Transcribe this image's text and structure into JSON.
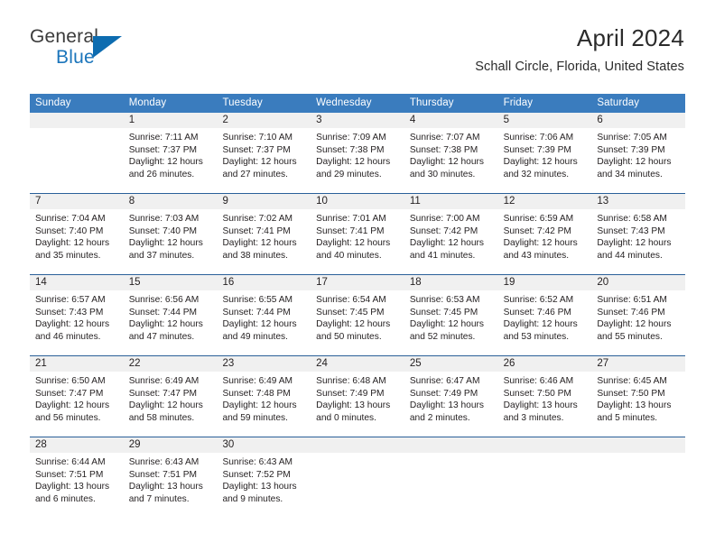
{
  "brand": {
    "name_part1": "General",
    "name_part2": "Blue",
    "logo_icon": "triangle-logo-icon"
  },
  "header": {
    "title": "April 2024",
    "subtitle": "Schall Circle, Florida, United States"
  },
  "calendar": {
    "weekdays": [
      "Sunday",
      "Monday",
      "Tuesday",
      "Wednesday",
      "Thursday",
      "Friday",
      "Saturday"
    ],
    "accent_color": "#3a7cbe",
    "daynum_band_color": "#f0f0f0",
    "weeks": [
      [
        {
          "day": "",
          "sunrise": "",
          "sunset": "",
          "daylight1": "",
          "daylight2": ""
        },
        {
          "day": "1",
          "sunrise": "Sunrise: 7:11 AM",
          "sunset": "Sunset: 7:37 PM",
          "daylight1": "Daylight: 12 hours",
          "daylight2": "and 26 minutes."
        },
        {
          "day": "2",
          "sunrise": "Sunrise: 7:10 AM",
          "sunset": "Sunset: 7:37 PM",
          "daylight1": "Daylight: 12 hours",
          "daylight2": "and 27 minutes."
        },
        {
          "day": "3",
          "sunrise": "Sunrise: 7:09 AM",
          "sunset": "Sunset: 7:38 PM",
          "daylight1": "Daylight: 12 hours",
          "daylight2": "and 29 minutes."
        },
        {
          "day": "4",
          "sunrise": "Sunrise: 7:07 AM",
          "sunset": "Sunset: 7:38 PM",
          "daylight1": "Daylight: 12 hours",
          "daylight2": "and 30 minutes."
        },
        {
          "day": "5",
          "sunrise": "Sunrise: 7:06 AM",
          "sunset": "Sunset: 7:39 PM",
          "daylight1": "Daylight: 12 hours",
          "daylight2": "and 32 minutes."
        },
        {
          "day": "6",
          "sunrise": "Sunrise: 7:05 AM",
          "sunset": "Sunset: 7:39 PM",
          "daylight1": "Daylight: 12 hours",
          "daylight2": "and 34 minutes."
        }
      ],
      [
        {
          "day": "7",
          "sunrise": "Sunrise: 7:04 AM",
          "sunset": "Sunset: 7:40 PM",
          "daylight1": "Daylight: 12 hours",
          "daylight2": "and 35 minutes."
        },
        {
          "day": "8",
          "sunrise": "Sunrise: 7:03 AM",
          "sunset": "Sunset: 7:40 PM",
          "daylight1": "Daylight: 12 hours",
          "daylight2": "and 37 minutes."
        },
        {
          "day": "9",
          "sunrise": "Sunrise: 7:02 AM",
          "sunset": "Sunset: 7:41 PM",
          "daylight1": "Daylight: 12 hours",
          "daylight2": "and 38 minutes."
        },
        {
          "day": "10",
          "sunrise": "Sunrise: 7:01 AM",
          "sunset": "Sunset: 7:41 PM",
          "daylight1": "Daylight: 12 hours",
          "daylight2": "and 40 minutes."
        },
        {
          "day": "11",
          "sunrise": "Sunrise: 7:00 AM",
          "sunset": "Sunset: 7:42 PM",
          "daylight1": "Daylight: 12 hours",
          "daylight2": "and 41 minutes."
        },
        {
          "day": "12",
          "sunrise": "Sunrise: 6:59 AM",
          "sunset": "Sunset: 7:42 PM",
          "daylight1": "Daylight: 12 hours",
          "daylight2": "and 43 minutes."
        },
        {
          "day": "13",
          "sunrise": "Sunrise: 6:58 AM",
          "sunset": "Sunset: 7:43 PM",
          "daylight1": "Daylight: 12 hours",
          "daylight2": "and 44 minutes."
        }
      ],
      [
        {
          "day": "14",
          "sunrise": "Sunrise: 6:57 AM",
          "sunset": "Sunset: 7:43 PM",
          "daylight1": "Daylight: 12 hours",
          "daylight2": "and 46 minutes."
        },
        {
          "day": "15",
          "sunrise": "Sunrise: 6:56 AM",
          "sunset": "Sunset: 7:44 PM",
          "daylight1": "Daylight: 12 hours",
          "daylight2": "and 47 minutes."
        },
        {
          "day": "16",
          "sunrise": "Sunrise: 6:55 AM",
          "sunset": "Sunset: 7:44 PM",
          "daylight1": "Daylight: 12 hours",
          "daylight2": "and 49 minutes."
        },
        {
          "day": "17",
          "sunrise": "Sunrise: 6:54 AM",
          "sunset": "Sunset: 7:45 PM",
          "daylight1": "Daylight: 12 hours",
          "daylight2": "and 50 minutes."
        },
        {
          "day": "18",
          "sunrise": "Sunrise: 6:53 AM",
          "sunset": "Sunset: 7:45 PM",
          "daylight1": "Daylight: 12 hours",
          "daylight2": "and 52 minutes."
        },
        {
          "day": "19",
          "sunrise": "Sunrise: 6:52 AM",
          "sunset": "Sunset: 7:46 PM",
          "daylight1": "Daylight: 12 hours",
          "daylight2": "and 53 minutes."
        },
        {
          "day": "20",
          "sunrise": "Sunrise: 6:51 AM",
          "sunset": "Sunset: 7:46 PM",
          "daylight1": "Daylight: 12 hours",
          "daylight2": "and 55 minutes."
        }
      ],
      [
        {
          "day": "21",
          "sunrise": "Sunrise: 6:50 AM",
          "sunset": "Sunset: 7:47 PM",
          "daylight1": "Daylight: 12 hours",
          "daylight2": "and 56 minutes."
        },
        {
          "day": "22",
          "sunrise": "Sunrise: 6:49 AM",
          "sunset": "Sunset: 7:47 PM",
          "daylight1": "Daylight: 12 hours",
          "daylight2": "and 58 minutes."
        },
        {
          "day": "23",
          "sunrise": "Sunrise: 6:49 AM",
          "sunset": "Sunset: 7:48 PM",
          "daylight1": "Daylight: 12 hours",
          "daylight2": "and 59 minutes."
        },
        {
          "day": "24",
          "sunrise": "Sunrise: 6:48 AM",
          "sunset": "Sunset: 7:49 PM",
          "daylight1": "Daylight: 13 hours",
          "daylight2": "and 0 minutes."
        },
        {
          "day": "25",
          "sunrise": "Sunrise: 6:47 AM",
          "sunset": "Sunset: 7:49 PM",
          "daylight1": "Daylight: 13 hours",
          "daylight2": "and 2 minutes."
        },
        {
          "day": "26",
          "sunrise": "Sunrise: 6:46 AM",
          "sunset": "Sunset: 7:50 PM",
          "daylight1": "Daylight: 13 hours",
          "daylight2": "and 3 minutes."
        },
        {
          "day": "27",
          "sunrise": "Sunrise: 6:45 AM",
          "sunset": "Sunset: 7:50 PM",
          "daylight1": "Daylight: 13 hours",
          "daylight2": "and 5 minutes."
        }
      ],
      [
        {
          "day": "28",
          "sunrise": "Sunrise: 6:44 AM",
          "sunset": "Sunset: 7:51 PM",
          "daylight1": "Daylight: 13 hours",
          "daylight2": "and 6 minutes."
        },
        {
          "day": "29",
          "sunrise": "Sunrise: 6:43 AM",
          "sunset": "Sunset: 7:51 PM",
          "daylight1": "Daylight: 13 hours",
          "daylight2": "and 7 minutes."
        },
        {
          "day": "30",
          "sunrise": "Sunrise: 6:43 AM",
          "sunset": "Sunset: 7:52 PM",
          "daylight1": "Daylight: 13 hours",
          "daylight2": "and 9 minutes."
        },
        {
          "day": "",
          "sunrise": "",
          "sunset": "",
          "daylight1": "",
          "daylight2": ""
        },
        {
          "day": "",
          "sunrise": "",
          "sunset": "",
          "daylight1": "",
          "daylight2": ""
        },
        {
          "day": "",
          "sunrise": "",
          "sunset": "",
          "daylight1": "",
          "daylight2": ""
        },
        {
          "day": "",
          "sunrise": "",
          "sunset": "",
          "daylight1": "",
          "daylight2": ""
        }
      ]
    ]
  }
}
